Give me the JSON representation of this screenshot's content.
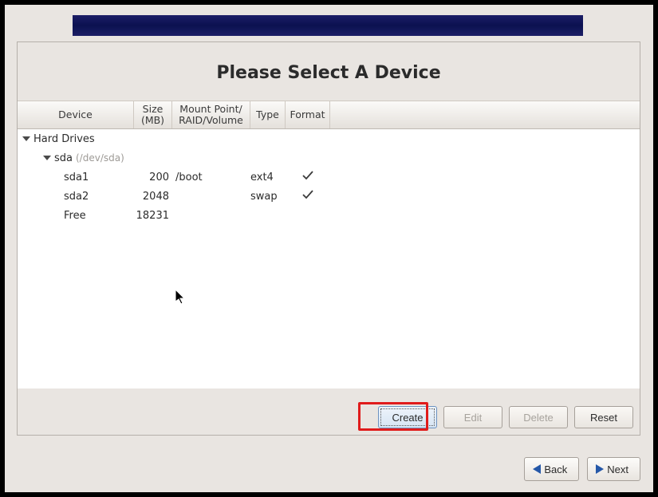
{
  "heading": "Please Select A Device",
  "columns": {
    "device": "Device",
    "size": "Size\n(MB)",
    "mount": "Mount Point/\nRAID/Volume",
    "type": "Type",
    "format": "Format"
  },
  "tree": {
    "root_label": "Hard Drives",
    "disk": {
      "name": "sda",
      "path": "(/dev/sda)"
    },
    "parts": [
      {
        "name": "sda1",
        "size": "200",
        "mount": "/boot",
        "type": "ext4",
        "format": true
      },
      {
        "name": "sda2",
        "size": "2048",
        "mount": "",
        "type": "swap",
        "format": true
      },
      {
        "name": "Free",
        "size": "18231",
        "mount": "",
        "type": "",
        "format": false
      }
    ]
  },
  "panel_buttons": {
    "create": "Create",
    "edit": "Edit",
    "delete": "Delete",
    "reset": "Reset"
  },
  "nav": {
    "back": "Back",
    "next": "Next"
  }
}
